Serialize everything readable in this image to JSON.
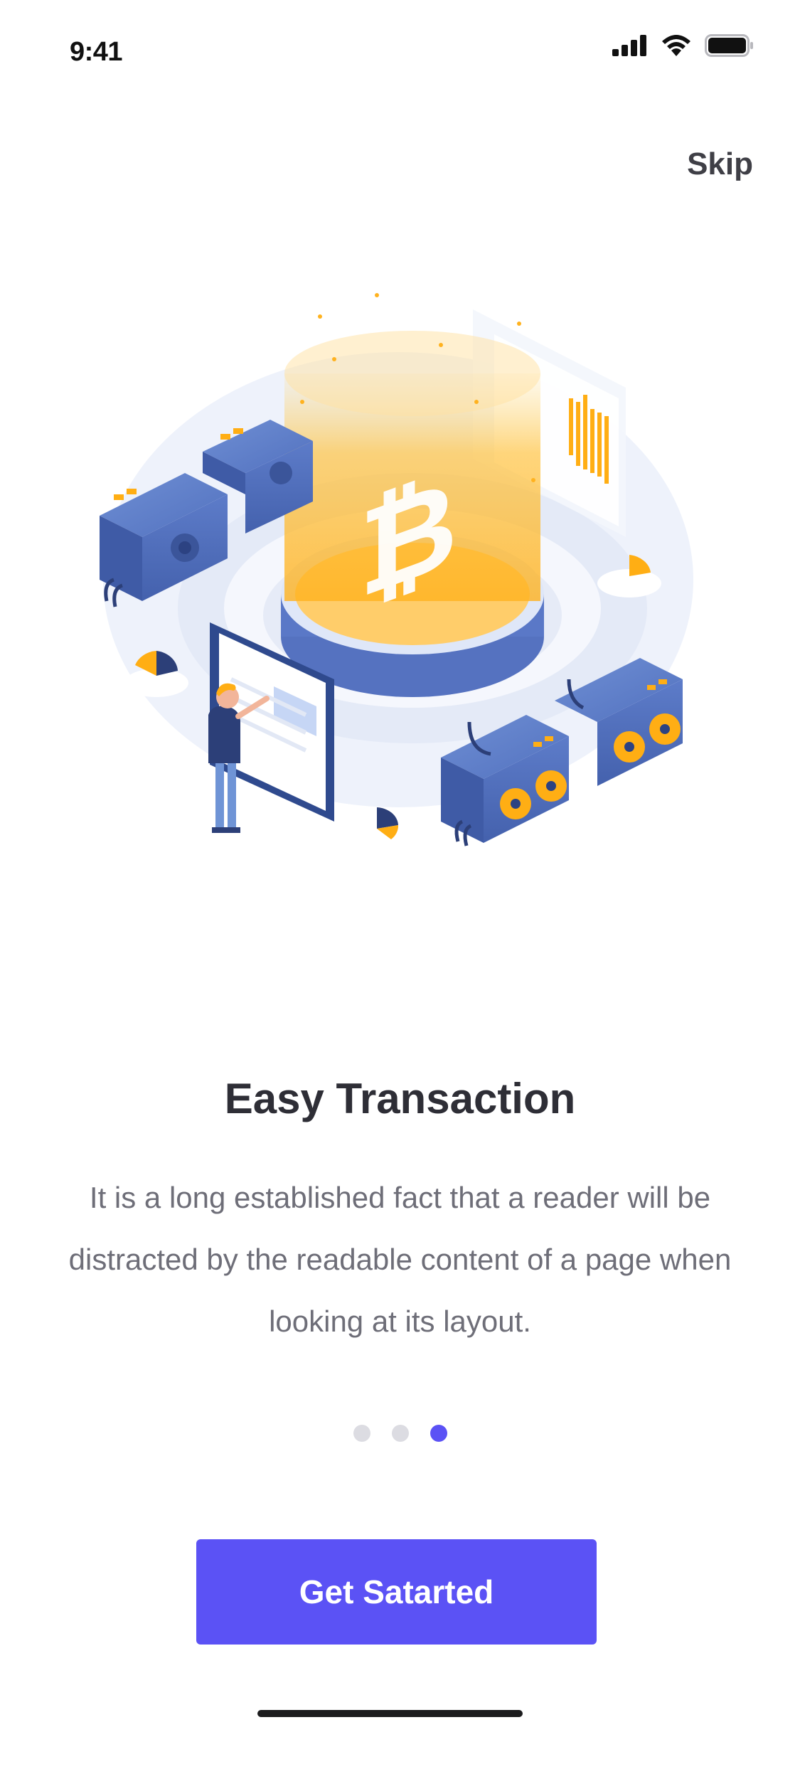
{
  "status_bar": {
    "time": "9:41",
    "signal_icon": "cellular-signal-icon",
    "wifi_icon": "wifi-icon",
    "battery_icon": "battery-icon"
  },
  "header": {
    "skip_label": "Skip"
  },
  "hero": {
    "illustration": "bitcoin-mining-illustration"
  },
  "onboarding": {
    "title": "Easy Transaction",
    "description": "It is a long established fact that a reader will be distracted by the readable content of a page when looking at its layout.",
    "pager": {
      "total": 3,
      "active_index": 2
    }
  },
  "cta": {
    "label": "Get Satarted"
  },
  "colors": {
    "accent": "#5b52f5",
    "inactive_dot": "#dcdce2",
    "title": "#2e2e36",
    "body_text": "#6e6e78"
  }
}
